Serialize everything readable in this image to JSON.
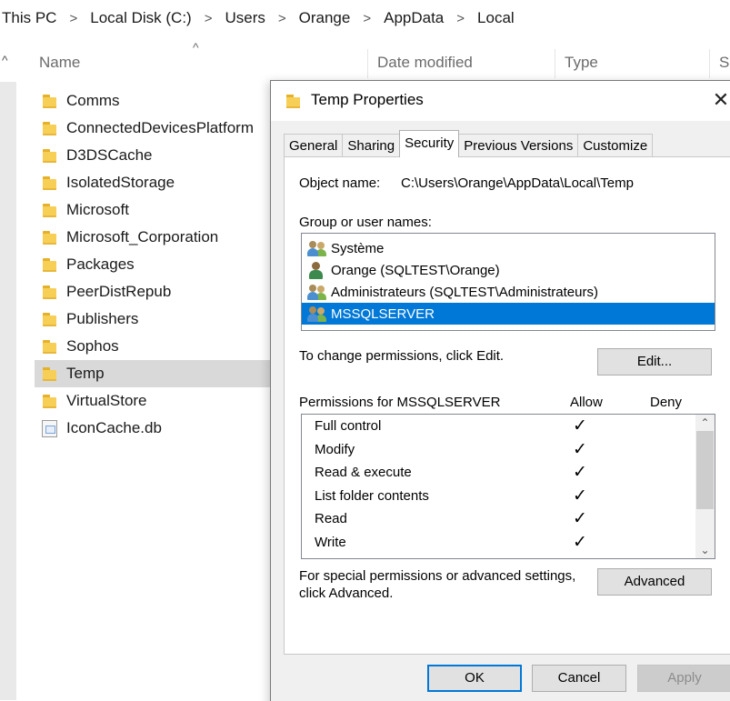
{
  "breadcrumb": {
    "items": [
      "This PC",
      "Local Disk (C:)",
      "Users",
      "Orange",
      "AppData",
      "Local"
    ],
    "separator": ">"
  },
  "columns": {
    "name": "Name",
    "date_modified": "Date modified",
    "type": "Type",
    "size": "Si"
  },
  "icons": {
    "sort_caret": "^",
    "nav_caret": "^",
    "close": "✕",
    "check": "✓",
    "scroll_up": "⌃",
    "scroll_down": "⌄"
  },
  "files": [
    {
      "name": "Comms",
      "kind": "folder"
    },
    {
      "name": "ConnectedDevicesPlatform",
      "kind": "folder"
    },
    {
      "name": "D3DSCache",
      "kind": "folder"
    },
    {
      "name": "IsolatedStorage",
      "kind": "folder"
    },
    {
      "name": "Microsoft",
      "kind": "folder"
    },
    {
      "name": "Microsoft_Corporation",
      "kind": "folder"
    },
    {
      "name": "Packages",
      "kind": "folder"
    },
    {
      "name": "PeerDistRepub",
      "kind": "folder"
    },
    {
      "name": "Publishers",
      "kind": "folder"
    },
    {
      "name": "Sophos",
      "kind": "folder"
    },
    {
      "name": "Temp",
      "kind": "folder",
      "selected": true
    },
    {
      "name": "VirtualStore",
      "kind": "folder"
    },
    {
      "name": "IconCache.db",
      "kind": "file"
    }
  ],
  "dialog": {
    "title": "Temp Properties",
    "tabs": [
      "General",
      "Sharing",
      "Security",
      "Previous Versions",
      "Customize"
    ],
    "active_tab": "Security",
    "object_name_label": "Object name:",
    "object_name_value": "C:\\Users\\Orange\\AppData\\Local\\Temp",
    "group_label": "Group or user names:",
    "users": [
      {
        "name": "Système",
        "icon": "users-icon"
      },
      {
        "name": "Orange (SQLTEST\\Orange)",
        "icon": "user-icon"
      },
      {
        "name": "Administrateurs (SQLTEST\\Administrateurs)",
        "icon": "users-icon"
      },
      {
        "name": "MSSQLSERVER",
        "icon": "users-icon",
        "selected": true
      }
    ],
    "change_text": "To change permissions, click Edit.",
    "edit_button": "Edit...",
    "perm_label": "Permissions for MSSQLSERVER",
    "allow_header": "Allow",
    "deny_header": "Deny",
    "permissions": [
      {
        "name": "Full control",
        "allow": true,
        "deny": false
      },
      {
        "name": "Modify",
        "allow": true,
        "deny": false
      },
      {
        "name": "Read & execute",
        "allow": true,
        "deny": false
      },
      {
        "name": "List folder contents",
        "allow": true,
        "deny": false
      },
      {
        "name": "Read",
        "allow": true,
        "deny": false
      },
      {
        "name": "Write",
        "allow": true,
        "deny": false
      }
    ],
    "special_text_line1": "For special permissions or advanced settings,",
    "special_text_line2": "click Advanced.",
    "advanced_button": "Advanced",
    "ok_button": "OK",
    "cancel_button": "Cancel",
    "apply_button": "Apply"
  },
  "colors": {
    "selection_blue": "#0078d7",
    "folder_yellow": "#f7cf56"
  }
}
